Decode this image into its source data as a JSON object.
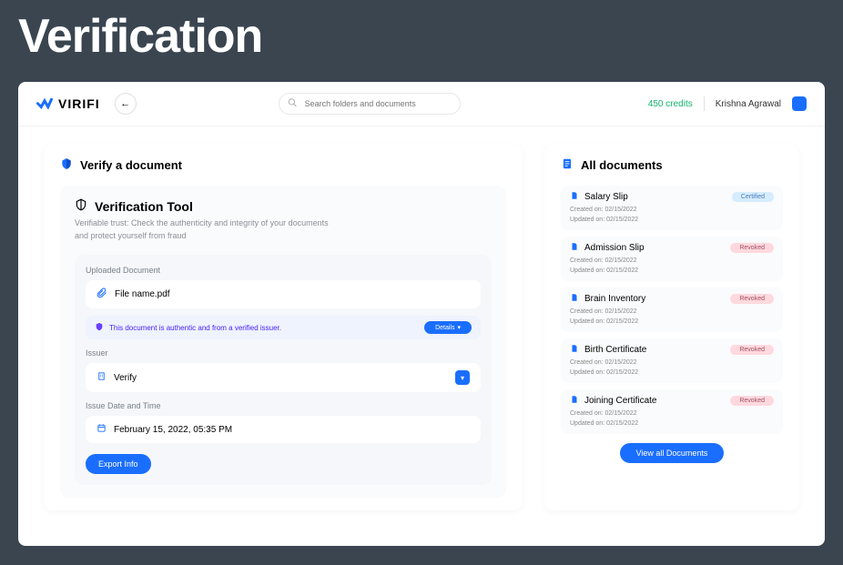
{
  "page_heading": "Verification",
  "header": {
    "brand": "VIRIFI",
    "search_placeholder": "Search folders and documents",
    "credits": "450 credits",
    "username": "Krishna Agrawal"
  },
  "verify_card": {
    "title": "Verify a document",
    "tool": {
      "title": "Verification Tool",
      "desc": "Verifiable trust: Check the authenticity and integrity of your documents and protect yourself from fraud",
      "uploaded_label": "Uploaded Document",
      "file_name": "File name.pdf",
      "verify_msg": "This document is authentic and from a verified issuer.",
      "details_label": "Details",
      "issuer_label": "Issuer",
      "issuer_value": "Verify",
      "date_label": "Issue Date and Time",
      "date_value": "February 15, 2022, 05:35 PM",
      "export_label": "Export Info"
    }
  },
  "docs_card": {
    "title": "All documents",
    "view_all_label": "View all Documents",
    "items": [
      {
        "name": "Salary Slip",
        "created": "Created on: 02/15/2022",
        "updated": "Updated on: 02/15/2022",
        "status": "Certified",
        "status_class": "badge-certified"
      },
      {
        "name": "Admission Slip",
        "created": "Created on: 02/15/2022",
        "updated": "Updated on: 02/15/2022",
        "status": "Revoked",
        "status_class": "badge-revoked"
      },
      {
        "name": "Brain Inventory",
        "created": "Created on: 02/15/2022",
        "updated": "Updated on: 02/15/2022",
        "status": "Revoked",
        "status_class": "badge-revoked"
      },
      {
        "name": "Birth Certificate",
        "created": "Created on: 02/15/2022",
        "updated": "Updated on: 02/15/2022",
        "status": "Revoked",
        "status_class": "badge-revoked"
      },
      {
        "name": "Joining Certificate",
        "created": "Created on: 02/15/2022",
        "updated": "Updated on: 02/15/2022",
        "status": "Revoked",
        "status_class": "badge-revoked"
      }
    ]
  }
}
